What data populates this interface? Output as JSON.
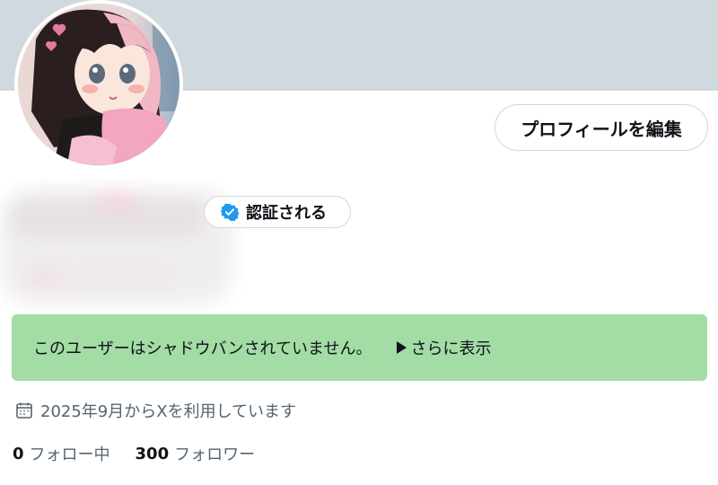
{
  "profile": {
    "edit_button_label": "プロフィールを編集",
    "verified_label": "認証される",
    "notice_text": "このユーザーはシャドウバンされていません。",
    "notice_more_label": "さらに表示",
    "joined_text": "2025年9月からXを利用しています",
    "following_count": "0",
    "following_label": "フォロー中",
    "followers_count": "300",
    "followers_label": "フォロワー"
  },
  "icons": {
    "verified": "verified-check-icon",
    "calendar": "calendar-icon",
    "triangle": "triangle-right-icon"
  },
  "colors": {
    "banner": "#cfd9de",
    "notice_bg": "#a3dca5",
    "verified_blue": "#1d9bf0",
    "text_primary": "#0f1419",
    "text_secondary": "#536471"
  }
}
